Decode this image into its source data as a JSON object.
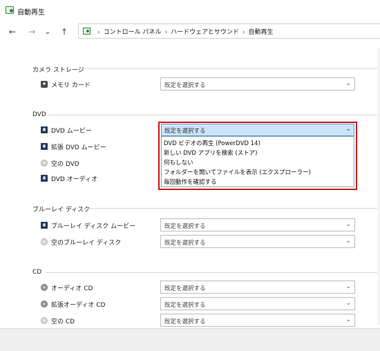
{
  "window": {
    "title": "自動再生"
  },
  "nav": {
    "back_icon": "←",
    "forward_icon": "→",
    "recent_icon": "⌄",
    "up_icon": "↑",
    "breadcrumbs": [
      "コントロール パネル",
      "ハードウェアとサウンド",
      "自動再生"
    ],
    "sep": "›"
  },
  "default_select": "既定を選択する",
  "chevron": "⌄",
  "groups": {
    "camera": {
      "label": "カメラ ストレージ",
      "items": [
        {
          "label": "メモリ カード",
          "icon": "camera-icon"
        }
      ]
    },
    "dvd": {
      "label": "DVD",
      "items": [
        {
          "label": "DVD ムービー",
          "icon": "dvd-icon"
        },
        {
          "label": "拡張 DVD ムービー",
          "icon": "dvd-icon"
        },
        {
          "label": "空の DVD",
          "icon": "disc-icon"
        },
        {
          "label": "DVD オーディオ",
          "icon": "dvd-icon"
        }
      ],
      "dropdown": {
        "selected": "既定を選択する",
        "options": [
          "DVD ビデオの再生 (PowerDVD 14)",
          "新しい DVD アプリを検索 (ストア)",
          "何もしない",
          "フォルダーを開いてファイルを表示 (エクスプローラー)",
          "毎回動作を確認する"
        ]
      }
    },
    "bluray": {
      "label": "ブルーレイ ディスク",
      "items": [
        {
          "label": "ブルーレイ ディスク ムービー",
          "icon": "dvd-icon"
        },
        {
          "label": "空のブルーレイ ディスク",
          "icon": "disc-icon"
        }
      ]
    },
    "cd": {
      "label": "CD",
      "items": [
        {
          "label": "オーディオ CD",
          "icon": "cd-icon"
        },
        {
          "label": "拡張オーディオ CD",
          "icon": "cd-icon"
        },
        {
          "label": "空の CD",
          "icon": "disc-icon"
        }
      ]
    }
  }
}
